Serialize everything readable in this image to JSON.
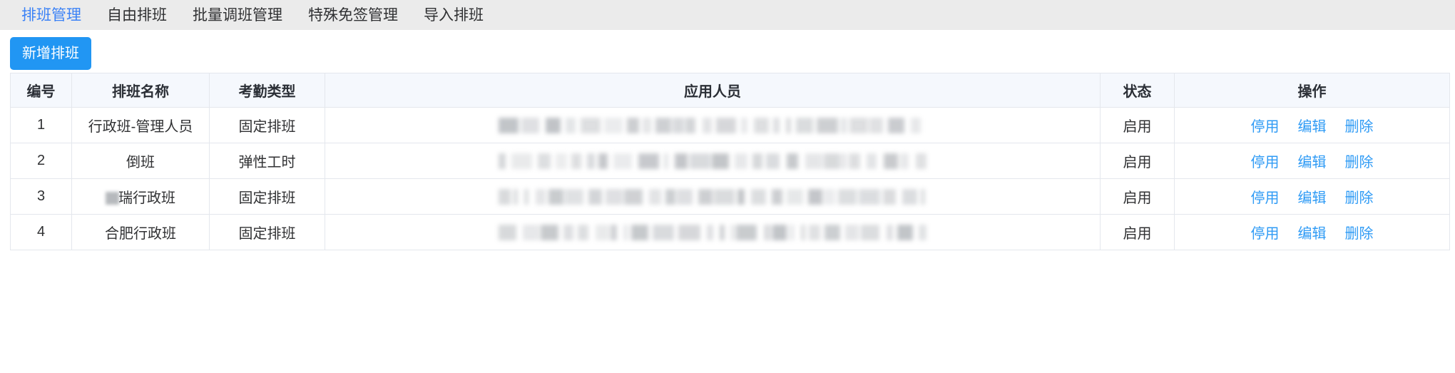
{
  "tabs": [
    {
      "label": "排班管理",
      "active": true
    },
    {
      "label": "自由排班",
      "active": false
    },
    {
      "label": "批量调班管理",
      "active": false
    },
    {
      "label": "特殊免签管理",
      "active": false
    },
    {
      "label": "导入排班",
      "active": false
    }
  ],
  "toolbar": {
    "add_label": "新增排班"
  },
  "table": {
    "columns": [
      "编号",
      "排班名称",
      "考勤类型",
      "应用人员",
      "状态",
      "操作"
    ],
    "rows": [
      {
        "id": "1",
        "name": "行政班-管理人员",
        "type": "固定排班",
        "staff": "",
        "staff_redacted": true,
        "state": "启用",
        "ops": [
          "停用",
          "编辑",
          "删除"
        ]
      },
      {
        "id": "2",
        "name": "倒班",
        "type": "弹性工时",
        "staff": "",
        "staff_redacted": true,
        "state": "启用",
        "ops": [
          "停用",
          "编辑",
          "删除"
        ]
      },
      {
        "id": "3",
        "name": "瑞行政班",
        "type": "固定排班",
        "staff": "",
        "staff_redacted": true,
        "state": "启用",
        "ops": [
          "停用",
          "编辑",
          "删除"
        ]
      },
      {
        "id": "4",
        "name": "合肥行政班",
        "type": "固定排班",
        "staff": "",
        "staff_redacted": true,
        "state": "启用",
        "ops": [
          "停用",
          "编辑",
          "删除"
        ]
      }
    ]
  },
  "colors": {
    "accent": "#2196f3",
    "link": "#2f9bf5",
    "tab_active": "#3b82f6",
    "tabbar_bg": "#ebebeb",
    "header_bg": "#f5f8fd",
    "border": "#e4e7ed"
  }
}
